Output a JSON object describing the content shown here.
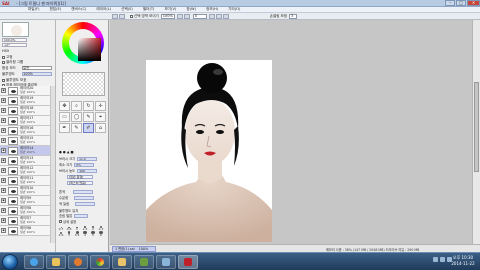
{
  "window": {
    "app_logo": "SAI",
    "title": "- [그림 트릴니 잰 마이쿼](1)]",
    "minimize": "–",
    "maximize": "□",
    "close": "✕"
  },
  "menu": [
    "파일(F)",
    "편집(E)",
    "캔버스(C)",
    "레이어(L)",
    "선택(S)",
    "필터(T)",
    "보기(V)",
    "창(W)",
    "정보(H)",
    "기타(O)"
  ],
  "toolbar": {
    "antialias_label": "선택 영역 보이기",
    "zoom_value": "100%",
    "rotate_value": "0",
    "stabilizer_label": "손떨림 보정",
    "stabilizer_value": "3"
  },
  "left_panel": {
    "navigator_zoom": "100.0%",
    "navigator_angle": "+0°",
    "hsv_label": "HSV",
    "checkbox_1": "고정",
    "checkbox_2": "클리핑 그룹",
    "blend_label": "합성 모드",
    "blend_value": "일반",
    "opacity_label": "불투명도",
    "opacity_value": "100%",
    "protect_label": "불투명도 보호",
    "clip_label": "하위 레이어에 클리핑",
    "select_label": "영역 선택 레이어 지정"
  },
  "layers": [
    {
      "name": "레이어20",
      "op": "일반 100%"
    },
    {
      "name": "레이어19",
      "op": "일반 100%"
    },
    {
      "name": "레이어18",
      "op": "일반 100%"
    },
    {
      "name": "레이어17",
      "op": "일반 100%"
    },
    {
      "name": "레이어16",
      "op": "일반 100%"
    },
    {
      "name": "레이어15",
      "op": "일반 100%"
    },
    {
      "name": "레이어14",
      "op": "일반 100%"
    },
    {
      "name": "레이어13",
      "op": "일반 100%"
    },
    {
      "name": "레이어12",
      "op": "일반 100%"
    },
    {
      "name": "레이어11",
      "op": "일반 100%"
    },
    {
      "name": "레이어10",
      "op": "일반 100%"
    },
    {
      "name": "레이어9",
      "op": "일반 100%"
    },
    {
      "name": "레이어8",
      "op": "일반 100%"
    },
    {
      "name": "레이어7",
      "op": "일반 100%"
    },
    {
      "name": "레이어6",
      "op": "일반 100%"
    }
  ],
  "selected_layer_index": 6,
  "tools": [
    "✥",
    "⌕",
    "↻",
    "✛",
    "▭",
    "◯",
    "✎",
    "⌖",
    "✒",
    "✎",
    "✐",
    "⌂"
  ],
  "tool_props": {
    "size_label": "브러시 크기",
    "size_value": "x1.0",
    "min_label": "최소 크기",
    "min_value": "0%",
    "density_label": "브러시 농도",
    "density_value": "100",
    "edge_label": "[일반 원형]",
    "texture_label": "[텍스처 없음]",
    "blend_label": "혼색",
    "water_label": "수분량",
    "color_ext_label": "색 늘림",
    "keep_label": "불투명도 유지",
    "blur_label": "흐림 필압",
    "detail_label": "상세 설정"
  },
  "brush_sizes": [
    "0.7",
    "0.8",
    "1",
    "1.5",
    "2",
    "2.3",
    "2.6",
    "3",
    "3.5",
    "4",
    "5",
    "6"
  ],
  "document": {
    "tab_label": "1 변환(1).sai",
    "tab_zoom": "100%"
  },
  "status": {
    "text": "메모리 사용 : 36% (147 MB / 2048 MB)   드라이브 여유 : 290 MB"
  },
  "taskbar": {
    "clock_time": "오후 10:30",
    "clock_date": "2014-11-22"
  },
  "colors": {
    "current_color": "#c0202a",
    "selected_layer": "#c4c8ec",
    "taskbar": "#1f3a5a"
  }
}
